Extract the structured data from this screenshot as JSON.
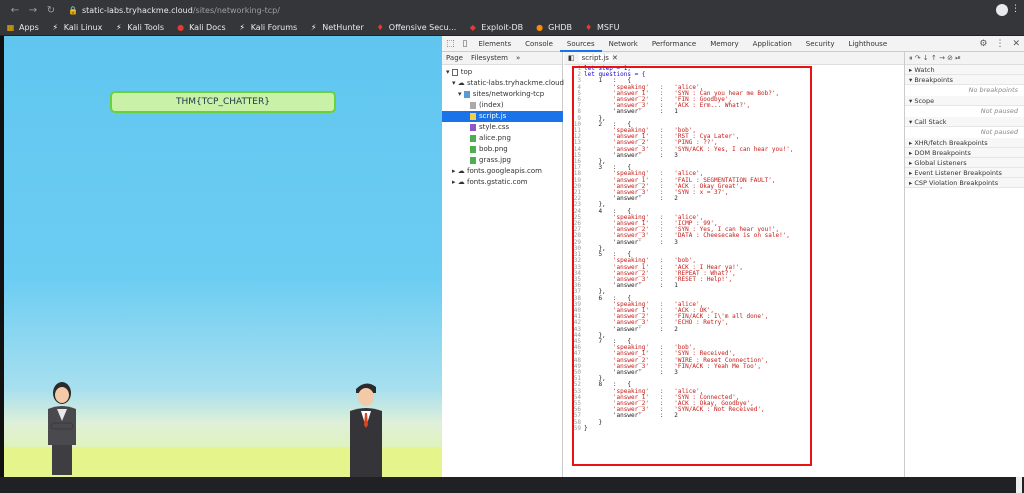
{
  "browser": {
    "url_host": "static-labs.tryhackme.cloud",
    "url_path": "/sites/networking-tcp/",
    "bookmarks": [
      "Apps",
      "Kali Linux",
      "Kali Tools",
      "Kali Docs",
      "Kali Forums",
      "NetHunter",
      "Offensive Secu...",
      "Exploit-DB",
      "GHDB",
      "MSFU"
    ]
  },
  "page": {
    "flag_text": "THM{TCP_CHATTER}"
  },
  "devtools": {
    "tabs": [
      "Elements",
      "Console",
      "Sources",
      "Network",
      "Performance",
      "Memory",
      "Application",
      "Security",
      "Lighthouse"
    ],
    "nav_tabs": [
      "Page",
      "Filesystem"
    ],
    "tree": [
      "top",
      "static-labs.tryhackme.cloud",
      "sites/networking-tcp",
      "(index)",
      "script.js",
      "style.css",
      "alice.png",
      "bob.png",
      "grass.jpg",
      "fonts.googleapis.com",
      "fonts.gstatic.com"
    ],
    "open_file": "script.js",
    "code": [
      "let step = 1;",
      "let questions = {",
      "    1   :   {",
      "        'speaking'   :   'alice',",
      "        'answer_1'   :   'SYN : Can you hear me Bob?',",
      "        'answer_2'   :   'FIN : Goodbye',",
      "        'answer_3'   :   'ACK : Erm... What?',",
      "        'answer'     :   1",
      "    },",
      "    2   :   {",
      "        'speaking'   :   'bob',",
      "        'answer_1'   :   'RST : Cya Later',",
      "        'answer_2'   :   'PING : ??',",
      "        'answer_3'   :   'SYN/ACK : Yes, I can hear you!',",
      "        'answer'     :   3",
      "    },",
      "    3   :   {",
      "        'speaking'   :   'alice',",
      "        'answer_1'   :   'FAIL : SEGMENTATION FAULT',",
      "        'answer_2'   :   'ACK : Okay Great',",
      "        'answer_3'   :   'SYN : x = 37',",
      "        'answer'     :   2",
      "    },",
      "    4   :   {",
      "        'speaking'   :   'alice',",
      "        'answer_1'   :   'ICMP : 99',",
      "        'answer_2'   :   'SYN : Yes, I can hear you!',",
      "        'answer_3'   :   'DATA : Cheesecake is on sale!',",
      "        'answer'     :   3",
      "    },",
      "    5   :   {",
      "        'speaking'   :   'bob',",
      "        'answer_1'   :   'ACK : I Hear ya!',",
      "        'answer_2'   :   'REPEAT : What?',",
      "        'answer_3'   :   'RESET : Help!',",
      "        'answer'     :   1",
      "    },",
      "    6   :   {",
      "        'speaking'   :   'alice',",
      "        'answer_1'   :   'ACK : OK',",
      "        'answer_2'   :   'FIN/ACK : I\\'m all done',",
      "        'answer_3'   :   'ECHO : Retry',",
      "        'answer'     :   2",
      "    },",
      "    7   :   {",
      "        'speaking'   :   'bob',",
      "        'answer_1'   :   'SYN : Received',",
      "        'answer_2'   :   'WIRE : Reset Connection',",
      "        'answer_3'   :   'FIN/ACK : Yeah Me Too',",
      "        'answer'     :   3",
      "    },",
      "    8   :   {",
      "        'speaking'   :   'alice',",
      "        'answer_1'   :   'SYN : Connected',",
      "        'answer_2'   :   'ACK : Okay, Goodbye',",
      "        'answer_3'   :   'SYN/ACK : Not Received',",
      "        'answer'     :   2",
      "    }",
      "}"
    ],
    "debugger": {
      "sections": [
        "Watch",
        "Breakpoints",
        "Scope",
        "Call Stack",
        "XHR/fetch Breakpoints",
        "DOM Breakpoints",
        "Global Listeners",
        "Event Listener Breakpoints",
        "CSP Violation Breakpoints"
      ],
      "no_breakpoints": "No breakpoints",
      "not_paused": "Not paused"
    }
  }
}
